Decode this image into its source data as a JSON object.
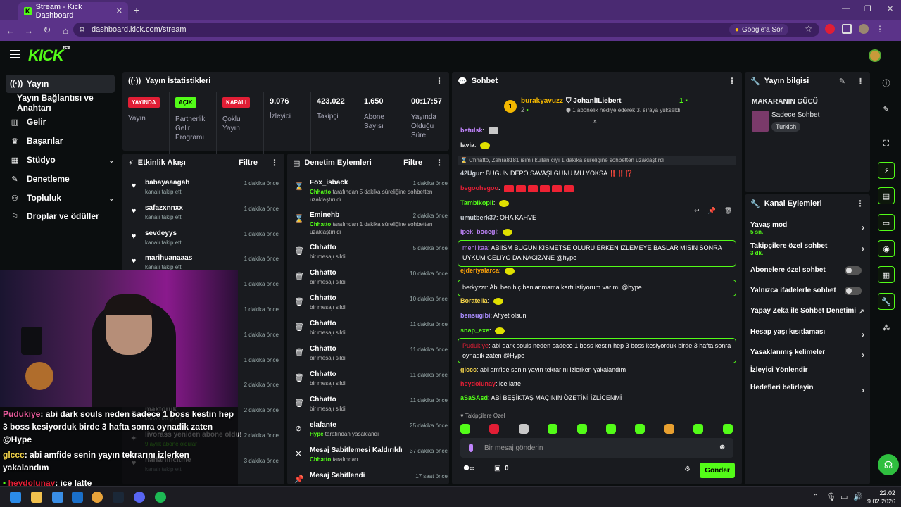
{
  "browser": {
    "tab_title": "Stream - Kick Dashboard",
    "url": "dashboard.kick.com/stream",
    "google_btn": "Google'a Sor"
  },
  "header": {
    "logo": "KICK",
    "logo_badge": "BETA"
  },
  "sidebar": {
    "items": [
      {
        "label": "Yayın",
        "icon": "broadcast-icon"
      },
      {
        "label": "Yayın Bağlantısı ve Anahtarı",
        "icon": ""
      },
      {
        "label": "Gelir",
        "icon": "revenue-icon"
      },
      {
        "label": "Başarılar",
        "icon": "trophy-icon"
      },
      {
        "label": "Stüdyo",
        "icon": "studio-icon"
      },
      {
        "label": "Denetleme",
        "icon": "wrench-icon"
      },
      {
        "label": "Topluluk",
        "icon": "community-icon"
      },
      {
        "label": "Droplar ve ödüller",
        "icon": "gift-icon"
      }
    ]
  },
  "stats": {
    "title": "Yayın İstatistikleri",
    "yayin_badge": "YAYINDA",
    "yayin_label": "Yayın",
    "partner_badge": "AÇIK",
    "partner_label": "Partnerlik Gelir Programı",
    "multi_badge": "KAPALI",
    "multi_label": "Çoklu Yayın",
    "viewers": "9.076",
    "viewers_label": "İzleyici",
    "followers": "423.022",
    "followers_label": "Takipçi",
    "subs": "1.650",
    "subs_label": "Abone Sayısı",
    "uptime": "00:17:57",
    "uptime_label": "Yayında Olduğu Süre"
  },
  "activity": {
    "title": "Etkinlik Akışı",
    "filter": "Filtre",
    "rows": [
      {
        "name": "babayaaagah",
        "sub": "kanalı takip etti",
        "time": "1 dakika önce"
      },
      {
        "name": "safazxnnxx",
        "sub": "kanalı takip etti",
        "time": "1 dakika önce"
      },
      {
        "name": "sevdeyys",
        "sub": "kanalı takip etti",
        "time": "1 dakika önce"
      },
      {
        "name": "marihuanaaas",
        "sub": "kanalı takip etti",
        "time": "1 dakika önce"
      },
      {
        "name": "",
        "sub": "",
        "time": "1 dakika önce"
      },
      {
        "name": "",
        "sub": "",
        "time": "1 dakika önce"
      },
      {
        "name": "",
        "sub": "",
        "time": "1 dakika önce"
      },
      {
        "name": "",
        "sub": "",
        "time": "1 dakika önce"
      },
      {
        "name": "",
        "sub": "",
        "time": "2 dakika önce"
      },
      {
        "name": "maktoruk",
        "sub": "kanalı takip etti",
        "time": "2 dakika önce"
      },
      {
        "name": "livorass yeniden abone oldu!",
        "sub": "9 aylık abone oldular",
        "time": "2 dakika önce"
      },
      {
        "name": "narlariincitme",
        "sub": "kanalı takip etti",
        "time": "3 dakika önce"
      }
    ]
  },
  "moderation": {
    "title": "Denetim Eylemleri",
    "filter": "Filtre",
    "rows": [
      {
        "icon": "hourglass-icon",
        "name": "Fox_isback",
        "actor": "Chhatto",
        "sub": " tarafından 5 dakika süreliğine sohbetten uzaklaştırıldı",
        "time": "1 dakika önce"
      },
      {
        "icon": "hourglass-icon",
        "name": "Eminehb",
        "actor": "Chhatto",
        "sub": " tarafından 1 dakika süreliğine sohbetten uzaklaştırıldı",
        "time": "2 dakika önce"
      },
      {
        "icon": "trash-icon",
        "name": "Chhatto",
        "actor": "",
        "sub": "bir mesajı sildi",
        "time": "5 dakika önce"
      },
      {
        "icon": "trash-icon",
        "name": "Chhatto",
        "actor": "",
        "sub": "bir mesajı sildi",
        "time": "10 dakika önce"
      },
      {
        "icon": "trash-icon",
        "name": "Chhatto",
        "actor": "",
        "sub": "bir mesajı sildi",
        "time": "10 dakika önce"
      },
      {
        "icon": "trash-icon",
        "name": "Chhatto",
        "actor": "",
        "sub": "bir mesajı sildi",
        "time": "11 dakika önce"
      },
      {
        "icon": "trash-icon",
        "name": "Chhatto",
        "actor": "",
        "sub": "bir mesajı sildi",
        "time": "11 dakika önce"
      },
      {
        "icon": "trash-icon",
        "name": "Chhatto",
        "actor": "",
        "sub": "bir mesajı sildi",
        "time": "11 dakika önce"
      },
      {
        "icon": "trash-icon",
        "name": "Chhatto",
        "actor": "",
        "sub": "bir mesajı sildi",
        "time": "11 dakika önce"
      },
      {
        "icon": "ban-icon",
        "name": "elafante",
        "actor": "Hype",
        "sub": " tarafından yasaklandı",
        "time": "25 dakika önce"
      },
      {
        "icon": "unpin-icon",
        "name": "Mesaj Sabitlemesi Kaldırıldı",
        "actor": "Chhatto",
        "sub": " tarafından",
        "time": "37 dakika önce"
      },
      {
        "icon": "pin-icon",
        "name": "Mesaj Sabitlendi",
        "actor": "",
        "sub": "",
        "time": "17 saat önce"
      }
    ]
  },
  "chat": {
    "title": "Sohbet",
    "top_user": "burakyavuzz",
    "top_rank": "1",
    "top_count": "2",
    "gifter": "JohanlILiebert",
    "gifter_count": "1",
    "gifter_msg": "1 abonelik hediye ederek 3. sıraya yükseldi",
    "messages": [
      {
        "user": "betulsk",
        "color": "#c084fc",
        "text": ""
      },
      {
        "user": "lavia",
        "color": "#e8e8e8",
        "text": ""
      },
      {
        "user": "",
        "color": "#fff",
        "text": "Chhatto, Zehra8181 isimli kullanıcıyı 1 dakika süreliğine sohbetten uzaklaştırdı"
      },
      {
        "user": "42Ugur",
        "color": "#c9cfd6",
        "text": "BUGÜN DEPO SAVAŞI GÜNÜ MU YOKSA ‼️‼️⁉️"
      },
      {
        "user": "begoohegoo",
        "color": "#e11e35",
        "text": ""
      },
      {
        "user": "Tambikopil",
        "color": "#53fc18",
        "text": ""
      },
      {
        "user": "umutberk37",
        "color": "#c9cfd6",
        "text": "OHA KAHVE"
      },
      {
        "user": "ipek_bocegi",
        "color": "#c084fc",
        "text": ""
      },
      {
        "user": "mehlikaa",
        "color": "#c084fc",
        "text": "ABIISM BUGUN KISMETSE OLURU ERKEN IZLEMEYE BASLAR MISIN SONRA UYKUM GELIYO DA NACIZANE @hype"
      },
      {
        "user": "ejderiyalarca",
        "color": "#f59e0b",
        "text": ""
      },
      {
        "user": "berkyzzr",
        "color": "#e8e8e8",
        "text": "Abi ben hiç banlanmama kartı istiyorum var mı @hype"
      },
      {
        "user": "Boratella",
        "color": "#f3d34a",
        "text": ""
      },
      {
        "user": "bensugibi",
        "color": "#a78bfa",
        "text": "Afiyet olsun"
      },
      {
        "user": "snap_exe",
        "color": "#53fc18",
        "text": ""
      },
      {
        "user": "Pudukiye",
        "color": "#e11e35",
        "text": "abi dark souls neden sadece 1 boss kestin hep 3 boss kesiyorduk birde 3 hafta sonra oynadik zaten @Hype"
      },
      {
        "user": "glccc",
        "color": "#f3d34a",
        "text": "abi amfide senin yayın tekrarını izlerken yakalandım"
      },
      {
        "user": "heydolunay",
        "color": "#e11e35",
        "text": "ice latte"
      },
      {
        "user": "aSaSAsd",
        "color": "#53fc18",
        "text": "ABİ BEŞİKTAŞ MAÇININ ÖZETİNİ İZLİCENMİ"
      }
    ],
    "followers_only": "Takipçilere Özel",
    "input_placeholder": "Bir mesaj gönderin",
    "points": "0",
    "send": "Gönder"
  },
  "stream_info": {
    "title": "Yayın bilgisi",
    "stream_title": "MAKARANIN GÜCÜ",
    "category": "Sadece Sohbet",
    "language": "Turkish"
  },
  "channel_actions": {
    "title": "Kanal Eylemleri",
    "rows": [
      {
        "label": "Yavaş mod",
        "sub": "5 sn.",
        "type": "chev"
      },
      {
        "label": "Takipçilere özel sohbet",
        "sub": "3 dk.",
        "type": "chev"
      },
      {
        "label": "Abonelere özel sohbet",
        "sub": "",
        "type": "toggle"
      },
      {
        "label": "Yalnızca ifadelerle sohbet",
        "sub": "",
        "type": "toggle"
      },
      {
        "label": "Yapay Zeka ile Sohbet Denetimi",
        "sub": "",
        "type": "ext"
      },
      {
        "label": "Hesap yaşı kısıtlaması",
        "sub": "",
        "type": "chev"
      },
      {
        "label": "Yasaklanmış kelimeler",
        "sub": "",
        "type": "chev"
      },
      {
        "label": "İzleyici Yönlendir",
        "sub": "",
        "type": "none"
      },
      {
        "label": "Hedefleri belirleyin",
        "sub": "",
        "type": "chev"
      }
    ]
  },
  "overlay": {
    "line1_user": "Pudukiye",
    "line1": ": abi dark souls neden sadece 1 boss kestin hep",
    "line2": "3 boss kesiyorduk birde 3 hafta sonra oynadik zaten",
    "line3": "@Hype",
    "line4_user": "glccc",
    "line4": ": abi amfide senin yayın tekrarını izlerken",
    "line5": "yakalandım",
    "line6_user": "heydolunay",
    "line6": ": ice latte"
  },
  "taskbar": {
    "time": "22:02",
    "date": "9.02.2026"
  },
  "colors": {
    "accent": "#53fc18",
    "live_red": "#e11e35",
    "panel": "#191b1f",
    "bg": "#0b0e0f"
  }
}
